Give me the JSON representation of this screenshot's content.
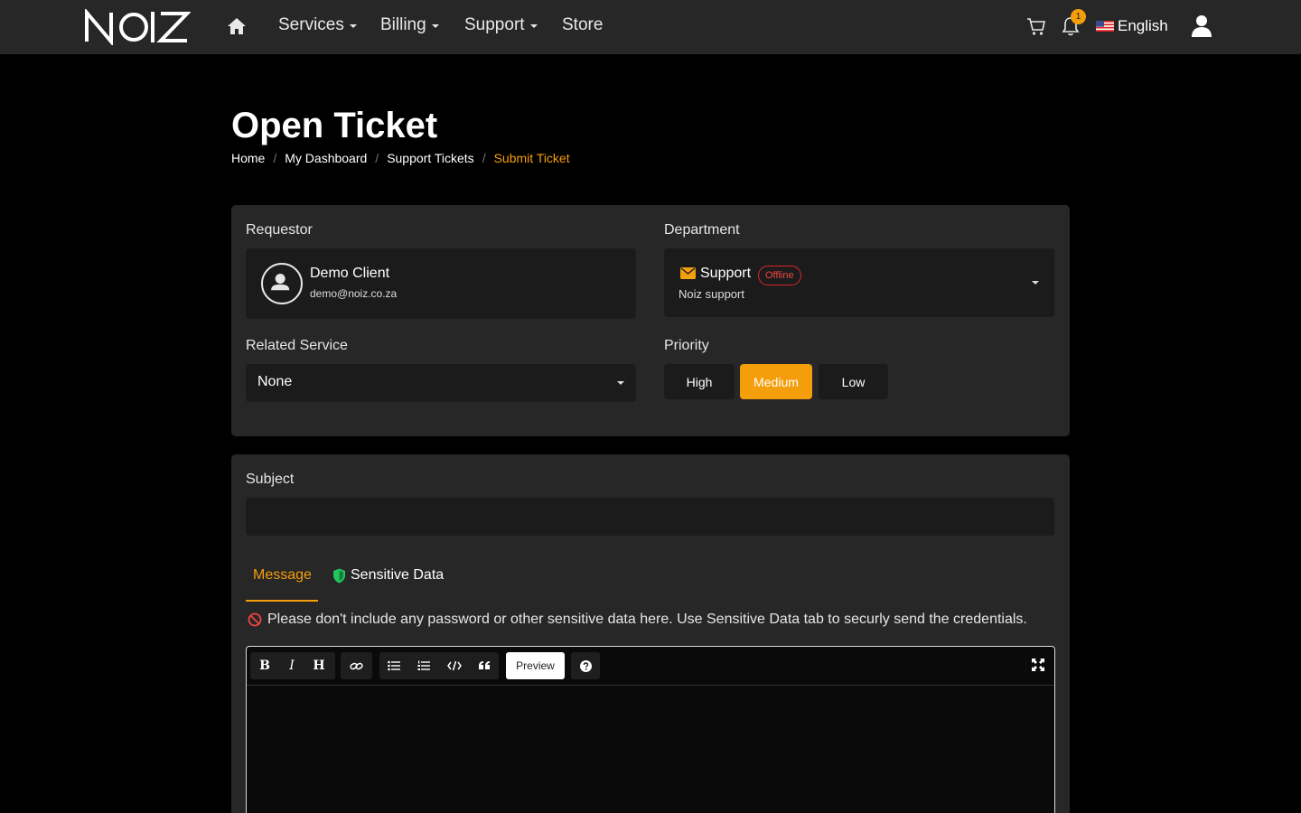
{
  "navbar": {
    "brand": "NOIZ",
    "items": [
      {
        "label": "Services",
        "dropdown": true
      },
      {
        "label": "Billing",
        "dropdown": true
      },
      {
        "label": "Support",
        "dropdown": true
      },
      {
        "label": "Store",
        "dropdown": false
      }
    ],
    "notification_count": "1",
    "language": "English"
  },
  "page": {
    "title": "Open Ticket",
    "breadcrumb": [
      "Home",
      "My Dashboard",
      "Support Tickets",
      "Submit Ticket"
    ]
  },
  "form": {
    "requestor_label": "Requestor",
    "requestor_name": "Demo Client",
    "requestor_email": "demo@noiz.co.za",
    "department_label": "Department",
    "department_name": "Support",
    "department_status": "Offline",
    "department_desc": "Noiz support",
    "service_label": "Related Service",
    "service_value": "None",
    "priority_label": "Priority",
    "priority_options": [
      "High",
      "Medium",
      "Low"
    ],
    "priority_selected": "Medium",
    "subject_label": "Subject",
    "subject_value": ""
  },
  "tabs": {
    "message": "Message",
    "sensitive": "Sensitive Data"
  },
  "warning": "Please don't include any password or other sensitive data here. Use Sensitive Data tab to securly send the credentials.",
  "editor": {
    "preview_label": "Preview",
    "bold": "B",
    "italic": "I",
    "heading": "H"
  },
  "colors": {
    "accent": "#f59e0b",
    "offline": "#dc2626",
    "shield": "#22c55e"
  }
}
